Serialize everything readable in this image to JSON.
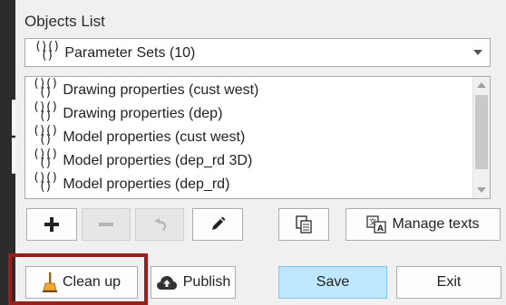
{
  "objects_list": {
    "title": "Objects List",
    "dropdown": {
      "selected": "Parameter Sets (10)"
    },
    "items": [
      "Drawing properties (cust west)",
      "Drawing properties (dep)",
      "Model properties (cust west)",
      "Model properties (dep_rd 3D)",
      "Model properties (dep_rd)"
    ],
    "item_icon": "parameter-set-icon"
  },
  "toolbar": {
    "add_icon": "plus-icon",
    "remove_icon": "minus-icon",
    "undo_icon": "undo-icon",
    "edit_icon": "pencil-icon",
    "copy_icon": "copy-icon",
    "manage_texts_label": "Manage texts",
    "manage_texts_icon": "translate-icon"
  },
  "actions": {
    "cleanup_label": "Clean up",
    "cleanup_icon": "broom-icon",
    "publish_label": "Publish",
    "publish_icon": "cloud-upload-icon",
    "save_label": "Save",
    "exit_label": "Exit"
  },
  "colors": {
    "highlight_border": "#9c1b1b",
    "save_button_bg": "#bfe7ff"
  }
}
